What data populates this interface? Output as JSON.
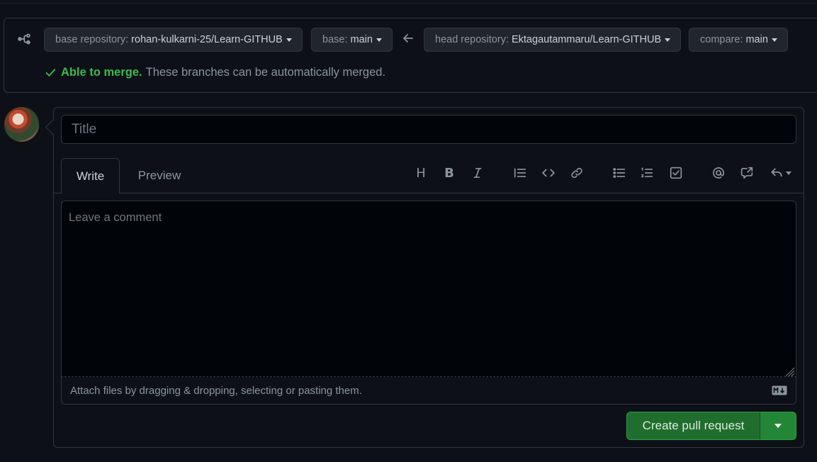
{
  "compare": {
    "base_repo_label": "base repository:",
    "base_repo_value": "rohan-kulkarni-25/Learn-GITHUB",
    "base_label": "base:",
    "base_value": "main",
    "head_repo_label": "head repository:",
    "head_repo_value": "Ektagautammaru/Learn-GITHUB",
    "compare_label": "compare:",
    "compare_value": "main",
    "merge_status": "Able to merge.",
    "merge_desc": "These branches can be automatically merged."
  },
  "form": {
    "title_placeholder": "Title",
    "tab_write": "Write",
    "tab_preview": "Preview",
    "comment_placeholder": "Leave a comment",
    "attach_text": "Attach files by dragging & dropping, selecting or pasting them.",
    "submit_label": "Create pull request"
  },
  "toolbar_icons": [
    "heading-icon",
    "bold-icon",
    "italic-icon",
    "quote-icon",
    "code-icon",
    "link-icon",
    "unordered-list-icon",
    "ordered-list-icon",
    "task-list-icon",
    "mention-icon",
    "reference-icon",
    "reply-icon"
  ],
  "colors": {
    "success": "#3fb950",
    "primary_button": "#238636"
  }
}
